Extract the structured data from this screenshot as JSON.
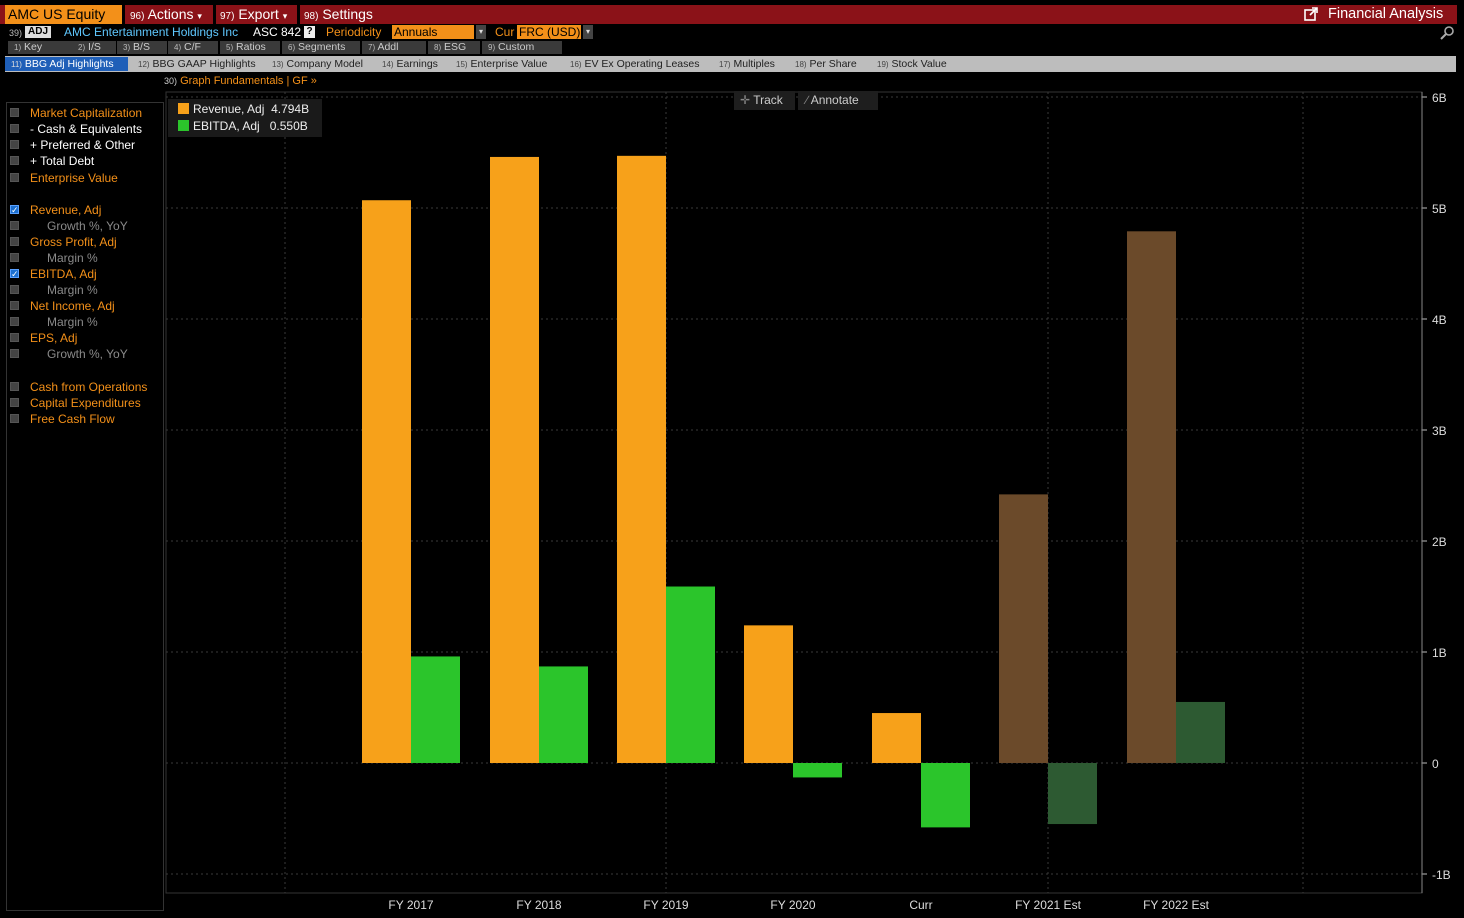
{
  "header": {
    "ticker": "AMC US Equity",
    "menus": [
      {
        "num": "96)",
        "label": "Actions",
        "arrow": "▾"
      },
      {
        "num": "97)",
        "label": "Export",
        "arrow": "▾"
      },
      {
        "num": "98)",
        "label": "Settings",
        "arrow": ""
      }
    ],
    "title": "Financial Analysis"
  },
  "info": {
    "num": "39)",
    "adj_badge": "ADJ",
    "company": "AMC Entertainment Holdings Inc",
    "asc": "ASC 842",
    "help": "?",
    "periodicity_label": "Periodicity",
    "periodicity_value": "Annuals",
    "cur_label": "Cur",
    "cur_value": "FRC (USD)"
  },
  "tabs_row1": [
    {
      "num": "1)",
      "label": "Key Stats"
    },
    {
      "num": "2)",
      "label": "I/S"
    },
    {
      "num": "3)",
      "label": "B/S"
    },
    {
      "num": "4)",
      "label": "C/F"
    },
    {
      "num": "5)",
      "label": "Ratios"
    },
    {
      "num": "6)",
      "label": "Segments"
    },
    {
      "num": "7)",
      "label": "Addl"
    },
    {
      "num": "8)",
      "label": "ESG"
    },
    {
      "num": "9)",
      "label": "Custom"
    }
  ],
  "tabs_row2": [
    {
      "num": "11)",
      "label": "BBG Adj Highlights"
    },
    {
      "num": "12)",
      "label": "BBG GAAP Highlights"
    },
    {
      "num": "13)",
      "label": "Company Model"
    },
    {
      "num": "14)",
      "label": "Earnings"
    },
    {
      "num": "15)",
      "label": "Enterprise Value"
    },
    {
      "num": "16)",
      "label": "EV Ex Operating Leases"
    },
    {
      "num": "17)",
      "label": "Multiples"
    },
    {
      "num": "18)",
      "label": "Per Share"
    },
    {
      "num": "19)",
      "label": "Stock Value"
    }
  ],
  "graph_link": {
    "num": "30)",
    "label": "Graph Fundamentals | GF »"
  },
  "left_panel": [
    {
      "label": "Market Capitalization",
      "checked": false,
      "style": "orange"
    },
    {
      "label": "- Cash & Equivalents",
      "checked": false,
      "style": "white"
    },
    {
      "label": "+ Preferred & Other",
      "checked": false,
      "style": "white"
    },
    {
      "label": "+ Total Debt",
      "checked": false,
      "style": "white"
    },
    {
      "label": "Enterprise Value",
      "checked": false,
      "style": "orange"
    },
    {
      "label": "Revenue, Adj",
      "checked": true,
      "style": "orange"
    },
    {
      "label": "Growth %, YoY",
      "checked": false,
      "style": "grey"
    },
    {
      "label": "Gross Profit, Adj",
      "checked": false,
      "style": "orange"
    },
    {
      "label": "Margin %",
      "checked": false,
      "style": "grey"
    },
    {
      "label": "EBITDA, Adj",
      "checked": true,
      "style": "orange"
    },
    {
      "label": "Margin %",
      "checked": false,
      "style": "grey"
    },
    {
      "label": "Net Income, Adj",
      "checked": false,
      "style": "orange"
    },
    {
      "label": "Margin %",
      "checked": false,
      "style": "grey"
    },
    {
      "label": "EPS, Adj",
      "checked": false,
      "style": "orange"
    },
    {
      "label": "Growth %, YoY",
      "checked": false,
      "style": "grey"
    },
    {
      "label": "Cash from Operations",
      "checked": false,
      "style": "orange"
    },
    {
      "label": "Capital Expenditures",
      "checked": false,
      "style": "orange"
    },
    {
      "label": "Free Cash Flow",
      "checked": false,
      "style": "orange"
    }
  ],
  "tools": {
    "track": "Track",
    "annotate": "Annotate"
  },
  "colors": {
    "accent_orange": "#f39019",
    "header_red": "#8b1218",
    "revenue": "#f7a11a",
    "ebitda": "#2bc52b",
    "revenue_est": "#6b4a2a",
    "ebitda_est": "#2d5a32"
  },
  "chart_data": {
    "type": "bar",
    "categories": [
      "FY 2017",
      "FY 2018",
      "FY 2019",
      "FY 2020",
      "Curr",
      "FY 2021 Est",
      "FY 2022 Est"
    ],
    "estimated": [
      false,
      false,
      false,
      false,
      false,
      true,
      true
    ],
    "series": [
      {
        "name": "Revenue, Adj",
        "legend_value": "4.794B",
        "values": [
          5.07,
          5.46,
          5.47,
          1.24,
          0.45,
          2.42,
          4.79
        ]
      },
      {
        "name": "EBITDA, Adj",
        "legend_value": "0.550B",
        "values": [
          0.96,
          0.87,
          1.59,
          -0.13,
          -0.58,
          -0.55,
          0.55
        ]
      }
    ],
    "y_ticks": [
      "6B",
      "5B",
      "4B",
      "3B",
      "2B",
      "1B",
      "0",
      "-1B"
    ],
    "y_tick_values": [
      6,
      5,
      4,
      3,
      2,
      1,
      0,
      -1
    ],
    "ylim": [
      -1.1,
      6.0
    ],
    "grid": true,
    "legend_position": "top-left"
  }
}
